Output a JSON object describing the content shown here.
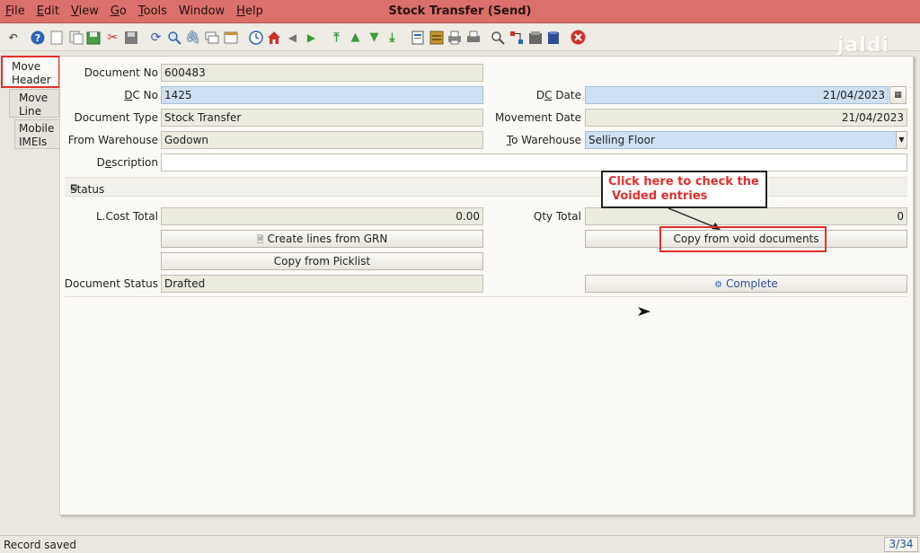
{
  "window": {
    "title": "Stock Transfer (Send)"
  },
  "menu": [
    {
      "key": "F",
      "rest": "ile"
    },
    {
      "key": "E",
      "rest": "dit"
    },
    {
      "key": "V",
      "rest": "iew"
    },
    {
      "key": "G",
      "rest": "o"
    },
    {
      "key": "T",
      "rest": "ools"
    },
    {
      "key": "",
      "rest": "Window"
    },
    {
      "key": "H",
      "rest": "elp"
    }
  ],
  "watermark": "jaldi",
  "tabs": {
    "move_header": "Move Header",
    "move_line": "Move Line",
    "mobile_imeis": "Mobile IMEIs"
  },
  "form": {
    "document_no_label": "Document No",
    "document_no": "600483",
    "dc_no_label_key": "D",
    "dc_no_label_rest": "C No",
    "dc_no": "1425",
    "dc_date_label_key": "D",
    "dc_date_label_pre": "",
    "dc_date_label_mid": "C",
    "dc_date_label_rest": " Date",
    "dc_date": "21/04/2023",
    "document_type_label": "Document Type",
    "document_type": "Stock Transfer",
    "movement_date_label": "Movement Date",
    "movement_date": "21/04/2023",
    "from_warehouse_label": "From Warehouse",
    "from_warehouse": "Godown",
    "to_warehouse_label_key": "T",
    "to_warehouse_label_rest": "o Warehouse",
    "to_warehouse": "Selling Floor",
    "description_label_pre": "D",
    "description_label_key": "e",
    "description_label_rest": "scription",
    "description": ""
  },
  "status_section": {
    "title": "Status",
    "lcost_total_label": "L.Cost Total",
    "lcost_total": "0.00",
    "qty_total_label": "Qty Total",
    "qty_total": "0",
    "create_lines_button": "Create lines from GRN",
    "copy_void_button": "Copy from void documents",
    "copy_picklist_button": "Copy from Picklist",
    "document_status_label": "Document Status",
    "document_status": "Drafted",
    "complete_button": "Complete"
  },
  "annotation": {
    "line1": "Click here to check the",
    "line2": "Voided entries"
  },
  "statusbar": {
    "message": "Record saved",
    "count": "3/34"
  },
  "colors": {
    "titlebar": "#d9706a",
    "highlight": "#e0302c",
    "blue_field": "#cfe0f2"
  }
}
